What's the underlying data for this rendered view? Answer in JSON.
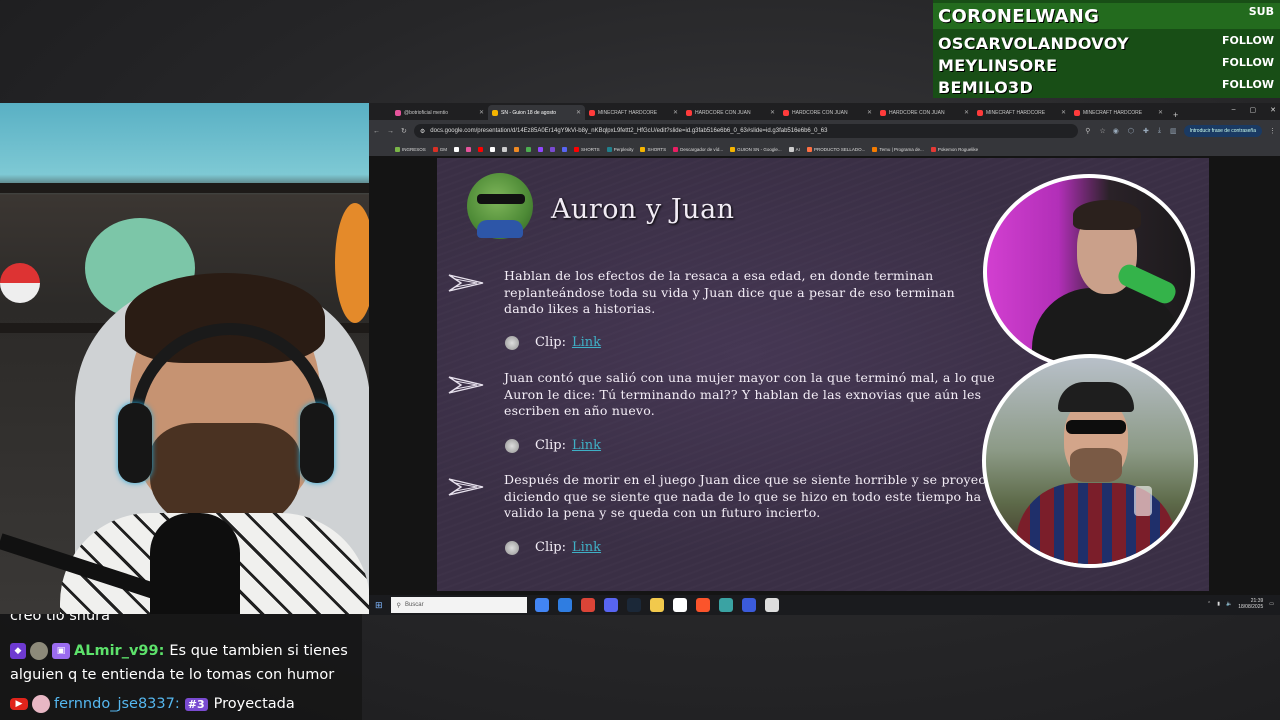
{
  "alerts": {
    "top": {
      "name": "CORONELWANG",
      "tag": "SUB"
    },
    "rows": [
      {
        "name": "OSCARVOLANDOVOY",
        "tag": "FOLLOW"
      },
      {
        "name": "MEYLINSORE",
        "tag": "FOLLOW"
      },
      {
        "name": "BEMILO3D",
        "tag": "FOLLOW"
      }
    ],
    "colors": {
      "primary": "#184e16",
      "highlight": "#236b1e"
    }
  },
  "browser": {
    "tabs": [
      {
        "title": "@botrioficial mentio",
        "color": "#e6549c"
      },
      {
        "title": "SN - Guion 18 de agosto",
        "color": "#f4b400",
        "active": true
      },
      {
        "title": "MINECRAFT HARDCORE",
        "color": "#ff3b3b"
      },
      {
        "title": "HARDCORE CON JUAN",
        "color": "#ff3b3b"
      },
      {
        "title": "HARDCORE CON JUAN",
        "color": "#ff3b3b"
      },
      {
        "title": "HARDCORE CON JUAN",
        "color": "#ff3b3b"
      },
      {
        "title": "MINECRAFT HARDCORE",
        "color": "#ff3b3b"
      },
      {
        "title": "MINECRAFT HARDCORE",
        "color": "#ff3b3b"
      }
    ],
    "new_tab": "+",
    "window_controls": [
      "–",
      "▢",
      "✕"
    ],
    "url": "docs.google.com/presentation/d/14Ez85A0Er14gY9kVi-b8y_nKBqlpxL9fettt2_HfGcU/edit?slide=id.g3fab516e6b6_0_63#slide=id.g3fab516e6b6_0_63",
    "profile_button": "Introducir frase de contraseña",
    "bookmarks": [
      {
        "label": "INGRESOS",
        "color": "#7ab648"
      },
      {
        "label": "GM",
        "color": "#d93025"
      },
      {
        "label": "",
        "color": "#ffffff"
      },
      {
        "label": "",
        "color": "#e6549c"
      },
      {
        "label": "",
        "color": "#ff0000"
      },
      {
        "label": "",
        "color": "#ffffff"
      },
      {
        "label": "",
        "color": "#cccccc"
      },
      {
        "label": "",
        "color": "#f08a24"
      },
      {
        "label": "",
        "color": "#4caf50"
      },
      {
        "label": "",
        "color": "#9146ff"
      },
      {
        "label": "",
        "color": "#7a4bd1"
      },
      {
        "label": "",
        "color": "#5865f2"
      },
      {
        "label": "SHORTS",
        "color": "#ff0000"
      },
      {
        "label": "Perplexity",
        "color": "#20808d"
      },
      {
        "label": "SHORTS",
        "color": "#f4b400"
      },
      {
        "label": "Descargador de víd...",
        "color": "#e91e63"
      },
      {
        "label": "GUION SN - Google...",
        "color": "#f4b400"
      },
      {
        "label": "AI",
        "color": "#cccccc"
      },
      {
        "label": "PRODUCTO SELLADO...",
        "color": "#ff7043"
      },
      {
        "label": "Temu | Programa de...",
        "color": "#f57c00"
      },
      {
        "label": "Pokemon Roguelike",
        "color": "#e53935"
      }
    ]
  },
  "slide": {
    "title": "Auron y Juan",
    "bullets": [
      {
        "text": "Hablan de los efectos de la resaca a esa edad, en donde terminan replanteándose toda su vida y Juan dice que a pesar de eso terminan dando likes a historias."
      },
      {
        "text": "Juan contó que salió con una mujer mayor con la que terminó mal, a lo que Auron le dice: Tú terminando mal?? Y hablan de las exnovias que aún les escriben en año nuevo."
      },
      {
        "text": "Después de morir en el juego Juan dice que se siente horrible y se proyecta diciendo que se siente que nada de lo que se hizo en todo este tiempo ha valido la pena y se queda con un futuro incierto."
      }
    ],
    "clip_label": "Clip:",
    "link_label": "Link",
    "colors": {
      "background": "#3a2f45",
      "link": "#3fb0c6"
    }
  },
  "taskbar": {
    "search_placeholder": "Buscar",
    "apps": [
      "#4285f4",
      "#2f7de1",
      "#db4437",
      "#5865f2",
      "#1b2838",
      "#f2c94c",
      "#ffffff",
      "#fb542b",
      "#3aa3a3",
      "#3b5bdb",
      "#dddddd"
    ],
    "time": "21:39",
    "date": "18/08/2025"
  },
  "chat": {
    "partial": "creo tio shura",
    "messages": [
      {
        "platform": "twitch",
        "user": "ALmir_v99:",
        "text": "Es que tambien si tienes",
        "continuation": "alguien q te entienda te lo tomas con humor"
      },
      {
        "platform": "youtube",
        "user": "fernndo_jse8337:",
        "rank": "#3",
        "text": "Proyectada"
      }
    ]
  }
}
